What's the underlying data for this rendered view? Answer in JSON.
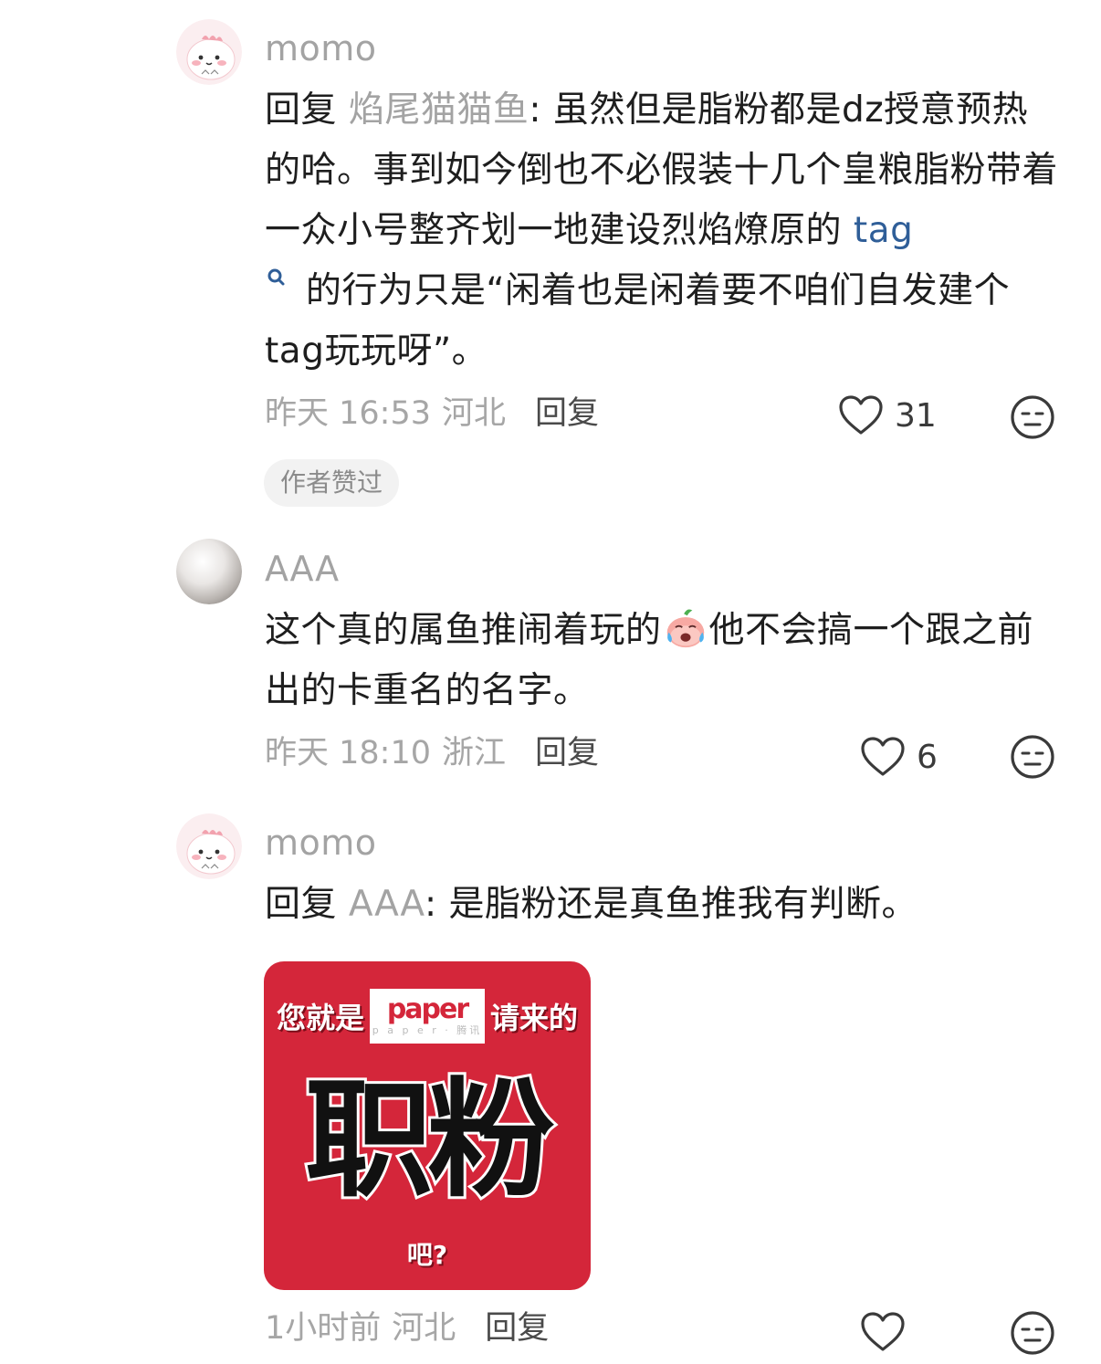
{
  "comments": [
    {
      "username": "momo",
      "reply_prefix": "回复 ",
      "reply_target": "焰尾猫猫鱼",
      "text_before_tag": ": 虽然但是脂粉都是dz授意预热的哈。事到如今倒也不必假装十几个皇粮脂粉带着一众小号整齐划一地建设烈焰燎原的 ",
      "tag_word": "tag",
      "text_after_tag": " 的行为只是“闲着也是闲着要不咱们自发建个tag玩玩呀”。",
      "time": "昨天 16:53",
      "location": "河北",
      "reply_label": "回复",
      "likes": "31",
      "badge": "作者赞过",
      "avatar_icon": "pink-dino-avatar"
    },
    {
      "username": "AAA",
      "text_before_emoji": "这个真的属鱼推闹着玩的",
      "emoji": "crying-peach-emoji",
      "text_after_emoji": "他不会搞一个跟之前出的卡重名的名字。",
      "time": "昨天 18:10",
      "location": "浙江",
      "reply_label": "回复",
      "likes": "6",
      "avatar_icon": "pearl-avatar"
    },
    {
      "username": "momo",
      "reply_prefix": "回复 ",
      "reply_target": "AAA",
      "text": ": 是脂粉还是真鱼推我有判断。",
      "sticker": {
        "top_left": "您就是",
        "logo_text": "paper",
        "logo_sub": "p a p e r · 腾讯",
        "top_right": "请来的",
        "big": "职粉",
        "bottom": "吧?",
        "bg_color": "#d4263a"
      },
      "time": "1小时前",
      "location": "河北",
      "reply_label": "回复",
      "likes": "",
      "avatar_icon": "pink-dino-avatar"
    }
  ],
  "icons": {
    "like": "heart-outline-icon",
    "dislike": "meh-face-icon",
    "tag": "search-icon"
  },
  "colors": {
    "username": "#a3a3a3",
    "link": "#2f5e98",
    "meta": "#a6a6a6"
  }
}
